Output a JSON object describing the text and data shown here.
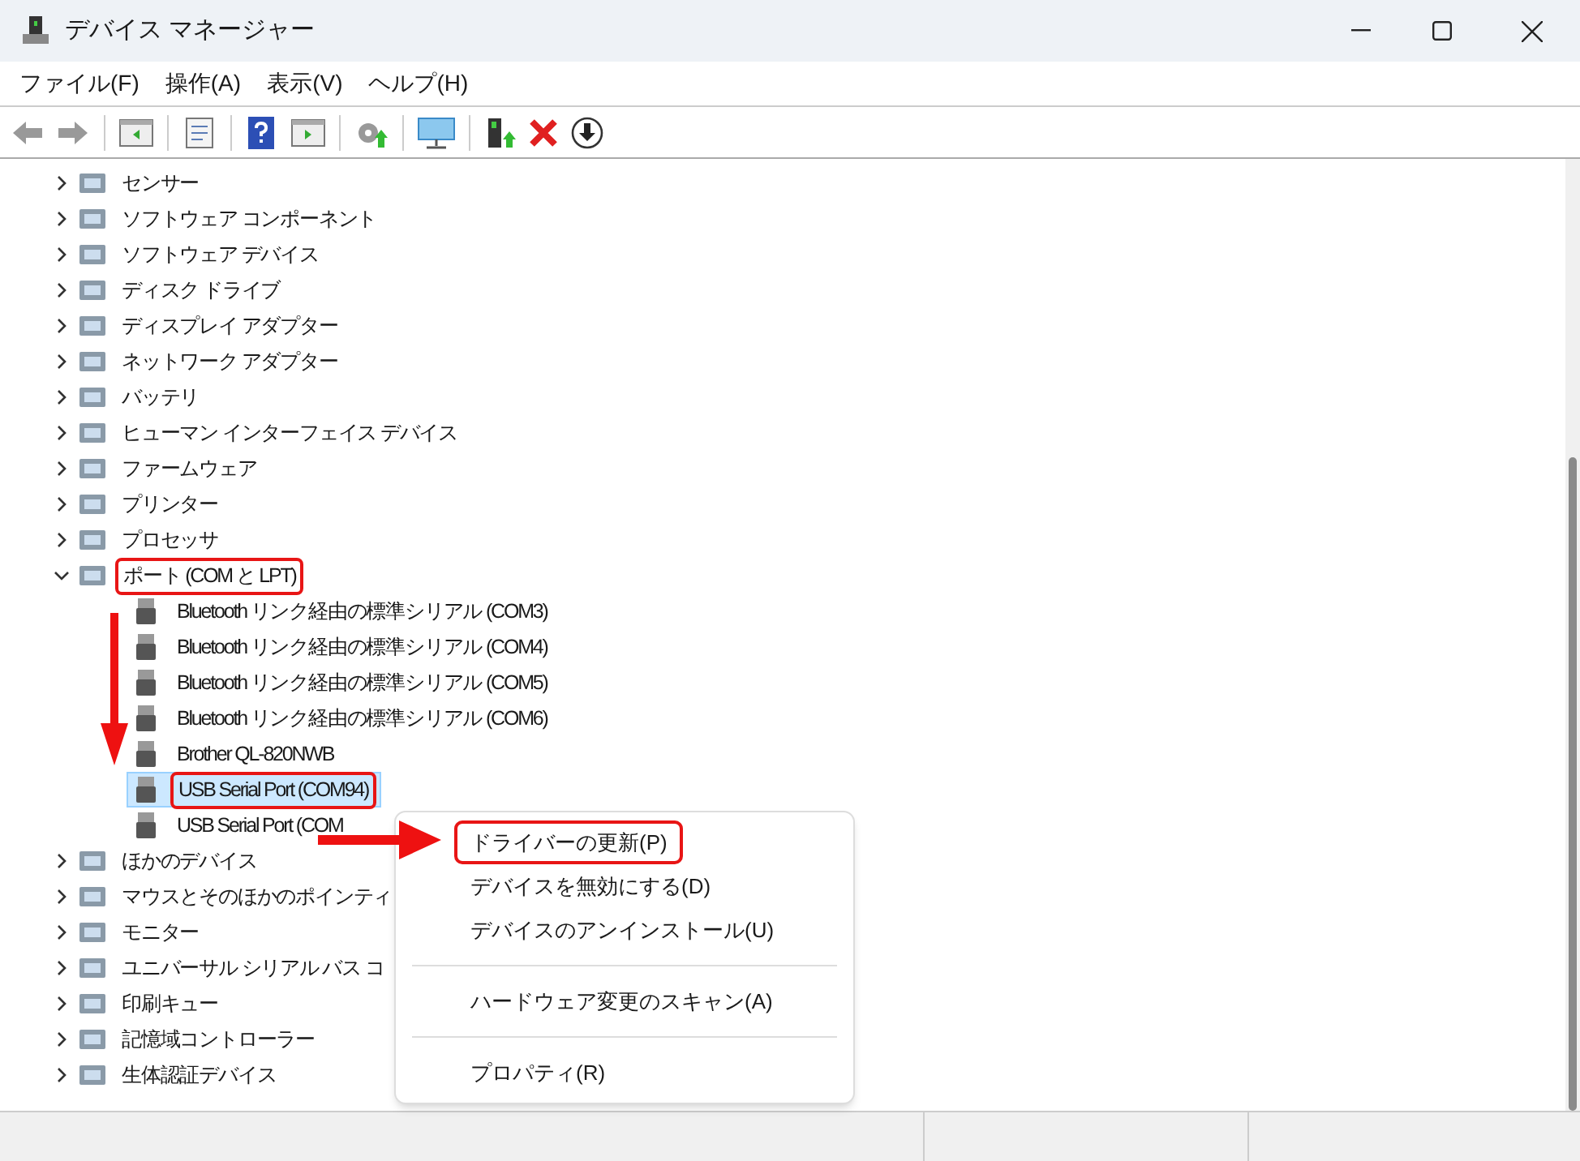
{
  "window": {
    "title": "デバイス マネージャー"
  },
  "menu_bar": [
    "ファイル(F)",
    "操作(A)",
    "表示(V)",
    "ヘルプ(H)"
  ],
  "tree": [
    {
      "label": "センサー",
      "expanded": false
    },
    {
      "label": "ソフトウェア コンポーネント",
      "expanded": false
    },
    {
      "label": "ソフトウェア デバイス",
      "expanded": false
    },
    {
      "label": "ディスク ドライブ",
      "expanded": false
    },
    {
      "label": "ディスプレイ アダプター",
      "expanded": false
    },
    {
      "label": "ネットワーク アダプター",
      "expanded": false
    },
    {
      "label": "バッテリ",
      "expanded": false
    },
    {
      "label": "ヒューマン インターフェイス デバイス",
      "expanded": false
    },
    {
      "label": "ファームウェア",
      "expanded": false
    },
    {
      "label": "プリンター",
      "expanded": false
    },
    {
      "label": "プロセッサ",
      "expanded": false
    },
    {
      "label": "ポート (COM と LPT)",
      "expanded": true,
      "highlighted": true,
      "children": [
        {
          "label": "Bluetooth リンク経由の標準シリアル (COM3)",
          "selected": false,
          "highlighted": false
        },
        {
          "label": "Bluetooth リンク経由の標準シリアル (COM4)",
          "selected": false,
          "highlighted": false
        },
        {
          "label": "Bluetooth リンク経由の標準シリアル (COM5)",
          "selected": false,
          "highlighted": false
        },
        {
          "label": "Bluetooth リンク経由の標準シリアル (COM6)",
          "selected": false,
          "highlighted": false
        },
        {
          "label": "Brother QL-820NWB",
          "selected": false,
          "highlighted": false
        },
        {
          "label": "USB Serial Port (COM94)",
          "selected": true,
          "highlighted": true
        },
        {
          "label": "USB Serial Port (COM",
          "selected": false,
          "highlighted": false
        }
      ]
    },
    {
      "label": "ほかのデバイス",
      "expanded": false
    },
    {
      "label": "マウスとそのほかのポインティ",
      "expanded": false
    },
    {
      "label": "モニター",
      "expanded": false
    },
    {
      "label": "ユニバーサル シリアル バス コ",
      "expanded": false
    },
    {
      "label": "印刷キュー",
      "expanded": false
    },
    {
      "label": "記憶域コントローラー",
      "expanded": false
    },
    {
      "label": "生体認証デバイス",
      "expanded": false
    }
  ],
  "context_menu": [
    {
      "kind": "item",
      "label": "ドライバーの更新(P)",
      "highlighted": true
    },
    {
      "kind": "item",
      "label": "デバイスを無効にする(D)",
      "highlighted": false
    },
    {
      "kind": "item",
      "label": "デバイスのアンインストール(U)",
      "highlighted": false
    },
    {
      "kind": "separator"
    },
    {
      "kind": "item",
      "label": "ハードウェア変更のスキャン(A)",
      "highlighted": false
    },
    {
      "kind": "separator"
    },
    {
      "kind": "item",
      "label": "プロパティ(R)",
      "highlighted": false
    }
  ]
}
